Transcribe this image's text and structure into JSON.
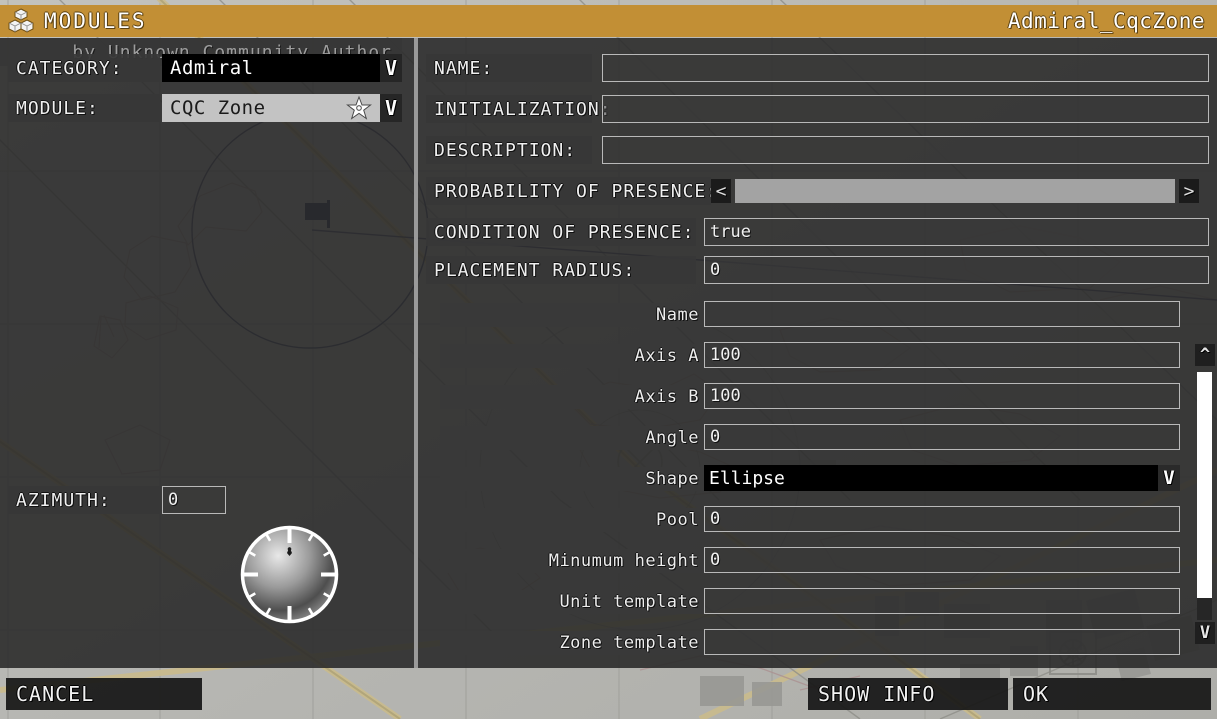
{
  "titlebar": {
    "icon": "modules-cubes-icon",
    "title": "MODULES",
    "object_name": "Admiral_CqcZone",
    "accent_color": "#c28f35"
  },
  "left_panel": {
    "category": {
      "label": "CATEGORY:",
      "value": "Admiral",
      "arrow": "V"
    },
    "module": {
      "label": "MODULE:",
      "value": "CQC Zone",
      "favorite_icon": "star-icon",
      "arrow": "V"
    },
    "author": "by Unknown Community Author",
    "azimuth": {
      "label": "AZIMUTH:",
      "value": "0"
    },
    "compass": "compass-dial"
  },
  "right_panel": {
    "fields": [
      {
        "label": "NAME:",
        "value": ""
      },
      {
        "label": "INITIALIZATION:",
        "value": ""
      },
      {
        "label": "DESCRIPTION:",
        "value": ""
      }
    ],
    "probability": {
      "label": "PROBABILITY OF PRESENCE:",
      "left_arrow": "<",
      "right_arrow": ">",
      "fill_percent": 100
    },
    "condition": {
      "label": "CONDITION OF PRESENCE:",
      "value": "true"
    },
    "placement": {
      "label": "PLACEMENT RADIUS:",
      "value": "0"
    },
    "attributes": [
      {
        "label": "Name",
        "value": "",
        "type": "text"
      },
      {
        "label": "Axis A",
        "value": "100",
        "type": "text"
      },
      {
        "label": "Axis B",
        "value": "100",
        "type": "text"
      },
      {
        "label": "Angle",
        "value": "0",
        "type": "text"
      },
      {
        "label": "Shape",
        "value": "Ellipse",
        "type": "combo",
        "arrow": "V"
      },
      {
        "label": "Pool",
        "value": "0",
        "type": "text"
      },
      {
        "label": "Minumum height",
        "value": "0",
        "type": "text"
      },
      {
        "label": "Unit template",
        "value": "",
        "type": "text"
      },
      {
        "label": "Zone template",
        "value": "",
        "type": "text"
      }
    ],
    "scrollbar": {
      "up_arrow": "^",
      "down_arrow": "V",
      "thumb_percent": 91
    }
  },
  "footer": {
    "cancel": "CANCEL",
    "show_info": "SHOW INFO",
    "ok": "OK"
  }
}
